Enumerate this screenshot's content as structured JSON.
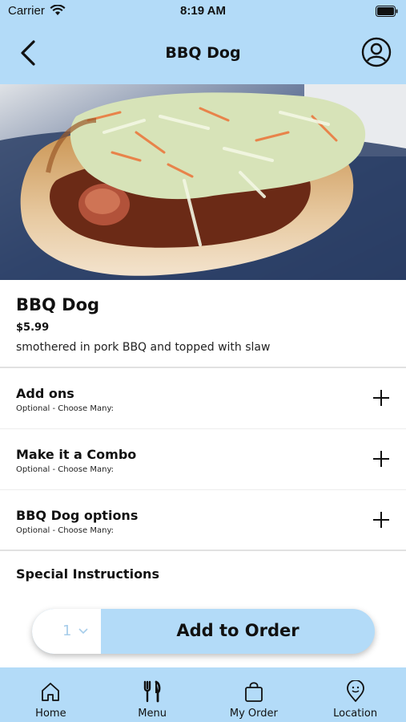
{
  "status_bar": {
    "carrier": "Carrier",
    "time": "8:19 AM"
  },
  "nav": {
    "title": "BBQ Dog"
  },
  "item": {
    "name": "BBQ Dog",
    "price": "$5.99",
    "description": "smothered in pork BBQ and topped with slaw"
  },
  "options": [
    {
      "title": "Add ons",
      "subtitle": "Optional - Choose Many:"
    },
    {
      "title": "Make it a Combo",
      "subtitle": "Optional - Choose Many:"
    },
    {
      "title": "BBQ Dog options",
      "subtitle": "Optional - Choose Many:"
    }
  ],
  "special_instructions": "Special Instructions",
  "order": {
    "quantity": "1",
    "add_label": "Add to Order"
  },
  "tabs": [
    {
      "label": "Home",
      "icon": "home-icon"
    },
    {
      "label": "Menu",
      "icon": "fork-knife-icon"
    },
    {
      "label": "My Order",
      "icon": "shopping-bag-icon"
    },
    {
      "label": "Location",
      "icon": "location-pin-icon"
    }
  ],
  "colors": {
    "accent": "#b3dbf8",
    "qty_text": "#a7cdea"
  }
}
